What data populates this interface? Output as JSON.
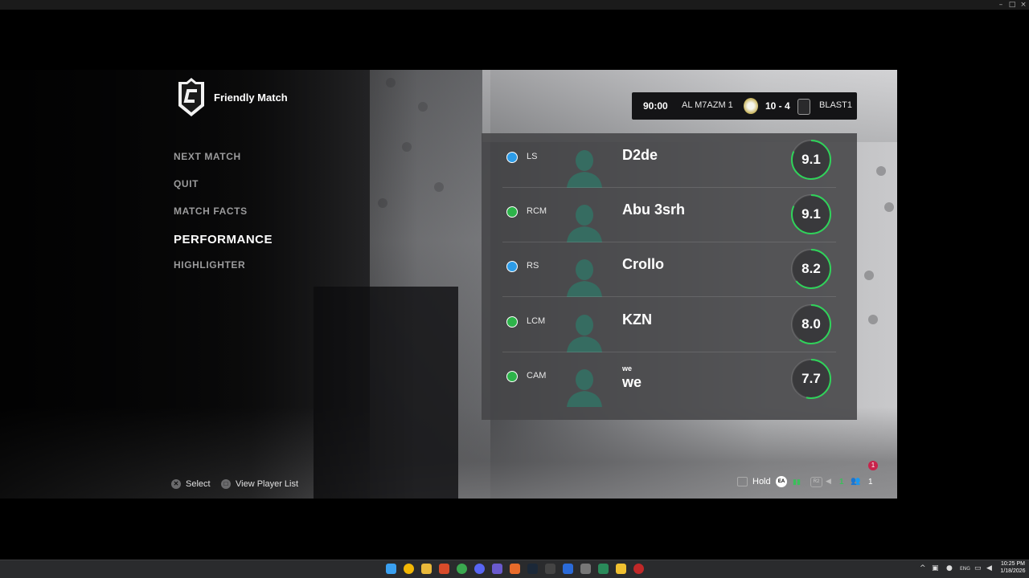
{
  "window": {
    "minimize_glyph": "–",
    "maximize_glyph": "□",
    "close_glyph": "×"
  },
  "header": {
    "mode_title": "Friendly Match"
  },
  "menu": {
    "items": [
      {
        "label": "NEXT MATCH"
      },
      {
        "label": "QUIT"
      },
      {
        "label": "MATCH FACTS"
      },
      {
        "label": "PERFORMANCE",
        "active": true
      },
      {
        "label": "HIGHLIGHTER"
      }
    ]
  },
  "scoreboard": {
    "time": "90:00",
    "home_team": "AL M7AZM 1",
    "score": "10 - 4",
    "away_team": "BLAST1"
  },
  "players": [
    {
      "position": "LS",
      "name": "D2de",
      "name_sub": "",
      "rating": "9.1",
      "rating_value": 9.1,
      "dot_color": "#2d9ce8"
    },
    {
      "position": "RCM",
      "name": "Abu 3srh",
      "name_sub": "",
      "rating": "9.1",
      "rating_value": 9.1,
      "dot_color": "#2db34a"
    },
    {
      "position": "RS",
      "name": "Crollo",
      "name_sub": "",
      "rating": "8.2",
      "rating_value": 8.2,
      "dot_color": "#2d9ce8"
    },
    {
      "position": "LCM",
      "name": "KZN",
      "name_sub": "",
      "rating": "8.0",
      "rating_value": 8.0,
      "dot_color": "#2db34a"
    },
    {
      "position": "CAM",
      "name": "we",
      "name_sub": "we",
      "rating": "7.7",
      "rating_value": 7.7,
      "dot_color": "#2db34a"
    }
  ],
  "footer": {
    "select_button_glyph": "✕",
    "select_label": "Select",
    "view_button_glyph": "□",
    "view_label": "View Player List",
    "hold_label": "Hold",
    "ea_label": "EA",
    "r2_label": "R2",
    "green_count": "1",
    "party_count": "1",
    "notification_count": "1"
  },
  "taskbar": {
    "clock_time": "10:25 PM",
    "clock_date": "1/18/2026",
    "tray_lang": "ENG"
  },
  "colors": {
    "rating_ring": "#2fd35a",
    "accent_blue": "#2d9ce8",
    "accent_green": "#2db34a",
    "notification": "#c8234b"
  }
}
